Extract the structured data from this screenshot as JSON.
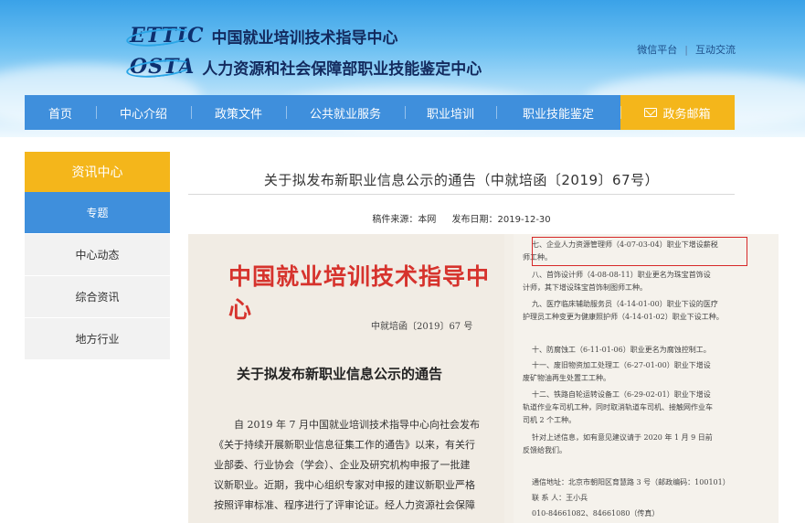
{
  "header": {
    "logo1_mark": "ETTIC",
    "logo1_text": "中国就业培训技术指导中心",
    "logo2_mark": "OSTA",
    "logo2_text": "人力资源和社会保障部职业技能鉴定中心",
    "link_wechat": "微信平台",
    "link_separator": "|",
    "link_interact": "互动交流"
  },
  "nav": {
    "items": [
      "首页",
      "中心介绍",
      "政策文件",
      "公共就业服务",
      "职业培训",
      "职业技能鉴定"
    ],
    "mail_label": "政务邮箱"
  },
  "sidebar": {
    "title": "资讯中心",
    "items": [
      "专题",
      "中心动态",
      "综合资讯",
      "地方行业"
    ]
  },
  "article": {
    "title": "关于拟发布新职业信息公示的通告（中就培函〔2019〕67号）",
    "source": "稿件来源：本网",
    "date": "发布日期：2019-12-30"
  },
  "document": {
    "org": "中国就业培训技术指导中心",
    "ref": "中就培函〔2019〕67 号",
    "heading": "关于拟发布新职业信息公示的通告",
    "para_lines": [
      "自 2019 年 7 月中国就业培训技术指导中心向社会发布",
      "《关于持续开展新职业信息征集工作的通告》以来，有关行",
      "业部委、行业协会（学会）、企业及研究机构申报了一批建",
      "议新职业。近期，我中心组织专家对申报的建议新职业严格",
      "按照评审标准、程序进行了评审论证。经人力资源社会保障"
    ],
    "right_lines": [
      "七、企业人力资源管理师（4-07-03-04）职业下增设薪税",
      "师工种。",
      "八、首饰设计师（4-08-08-11）职业更名为珠宝首饰设",
      "计师，其下增设珠宝首饰制图师工种。",
      "九、医疗临床辅助服务员（4-14-01-00）职业下设的医疗",
      "护理员工种变更为健康照护师（4-14-01-02）职业下设工种。",
      "十、防腐蚀工（6-11-01-06）职业更名为腐蚀控制工。",
      "十一、废旧物资加工处理工（6-27-01-00）职业下增设",
      "废矿物油再生处置工工种。",
      "十二、铁路自轮运转设备工（6-29-02-01）职业下增设",
      "轨道作业车司机工种，同时取消轨道车司机、接触网作业车",
      "司机 2 个工种。",
      "针对上述信息，如有意见建议请于 2020 年 1 月 9 日前",
      "反馈给我们。",
      "通信地址：北京市朝阳区育慧路 3 号（邮政编码：100101）",
      "联 系 人：王小兵",
      "010-84661082、84661080（传真）"
    ]
  },
  "colors": {
    "nav_blue": "#3f8fdc",
    "accent_orange": "#f4b61b",
    "seal_red": "#d6332d",
    "highlight_red": "#d62828"
  }
}
